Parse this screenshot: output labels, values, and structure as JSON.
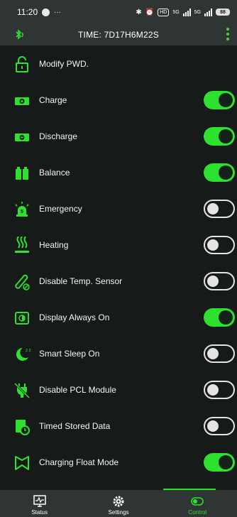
{
  "status_bar": {
    "time": "11:20",
    "hd_badge": "HD",
    "network_1": "5G",
    "network_2": "5G",
    "battery": "88"
  },
  "header": {
    "title": "TIME: 7D17H6M22S"
  },
  "colors": {
    "accent": "#2fe12f",
    "bar_background": "#2f3534",
    "page_background": "#161a19"
  },
  "settings": [
    {
      "label": "Modify PWD.",
      "icon": "lock-icon",
      "toggle": null
    },
    {
      "label": "Charge",
      "icon": "battery-charge-icon",
      "toggle": "on"
    },
    {
      "label": "Discharge",
      "icon": "battery-discharge-icon",
      "toggle": "on"
    },
    {
      "label": "Balance",
      "icon": "balance-icon",
      "toggle": "on"
    },
    {
      "label": "Emergency",
      "icon": "emergency-light-icon",
      "toggle": "off"
    },
    {
      "label": "Heating",
      "icon": "heating-icon",
      "toggle": "off"
    },
    {
      "label": "Disable Temp. Sensor",
      "icon": "thermometer-off-icon",
      "toggle": "off"
    },
    {
      "label": "Display Always On",
      "icon": "display-icon",
      "toggle": "on"
    },
    {
      "label": "Smart Sleep On",
      "icon": "moon-sleep-icon",
      "toggle": "off"
    },
    {
      "label": "Disable PCL Module",
      "icon": "plug-off-icon",
      "toggle": "off"
    },
    {
      "label": "Timed Stored Data",
      "icon": "timed-data-icon",
      "toggle": "off"
    },
    {
      "label": "Charging Float Mode",
      "icon": "flag-icon",
      "toggle": "on"
    }
  ],
  "bottom_nav": [
    {
      "label": "Status",
      "icon": "status-monitor-icon",
      "active": false
    },
    {
      "label": "Settings",
      "icon": "gear-icon",
      "active": false
    },
    {
      "label": "Control",
      "icon": "toggle-icon",
      "active": true
    }
  ]
}
